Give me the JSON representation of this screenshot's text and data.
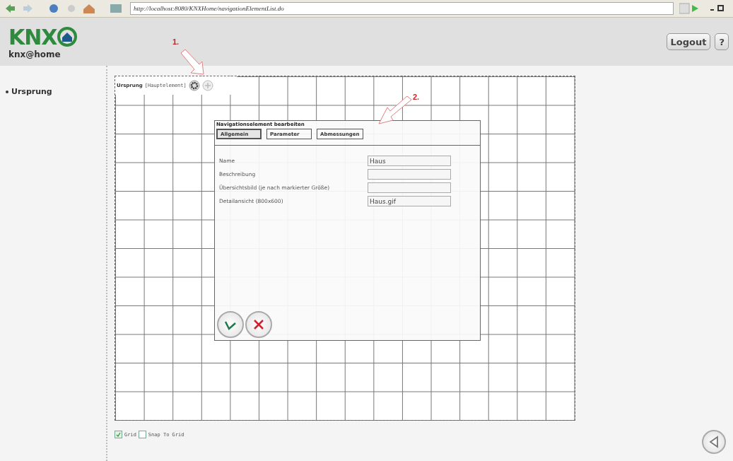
{
  "browser": {
    "url": "http://localhost:8080/KNXHome/navigationElementList.do"
  },
  "header": {
    "logo": {
      "letters": "KNX",
      "tagline": "knx@home"
    },
    "buttons": [
      {
        "kind": "text",
        "label": "Logout"
      },
      {
        "kind": "text",
        "label": "?"
      }
    ]
  },
  "sidebar": {
    "items": [
      {
        "label": "Ursprung"
      }
    ]
  },
  "canvas": {
    "element": {
      "name": "Ursprung",
      "type": "[Hauptelement]"
    },
    "annotations": [
      {
        "label": "1."
      },
      {
        "label": "2."
      }
    ]
  },
  "dialog": {
    "title": "Navigationselement bearbeiten",
    "tabs": [
      {
        "label": "Allgemein",
        "selected": true
      },
      {
        "label": "Parameter",
        "selected": false
      },
      {
        "label": "Abmessungen",
        "selected": false
      }
    ],
    "fields": [
      {
        "label": "Name",
        "value": "Haus"
      },
      {
        "label": "Beschreibung"
      },
      {
        "label": "Übersichtsbild (je nach markierter Größe)"
      },
      {
        "label": "Detailansicht (800x600)",
        "value": "Haus.gif"
      }
    ]
  },
  "options": [
    {
      "label": "Grid",
      "checked": true
    },
    {
      "label": "Snap To Grid",
      "checked": false
    }
  ]
}
